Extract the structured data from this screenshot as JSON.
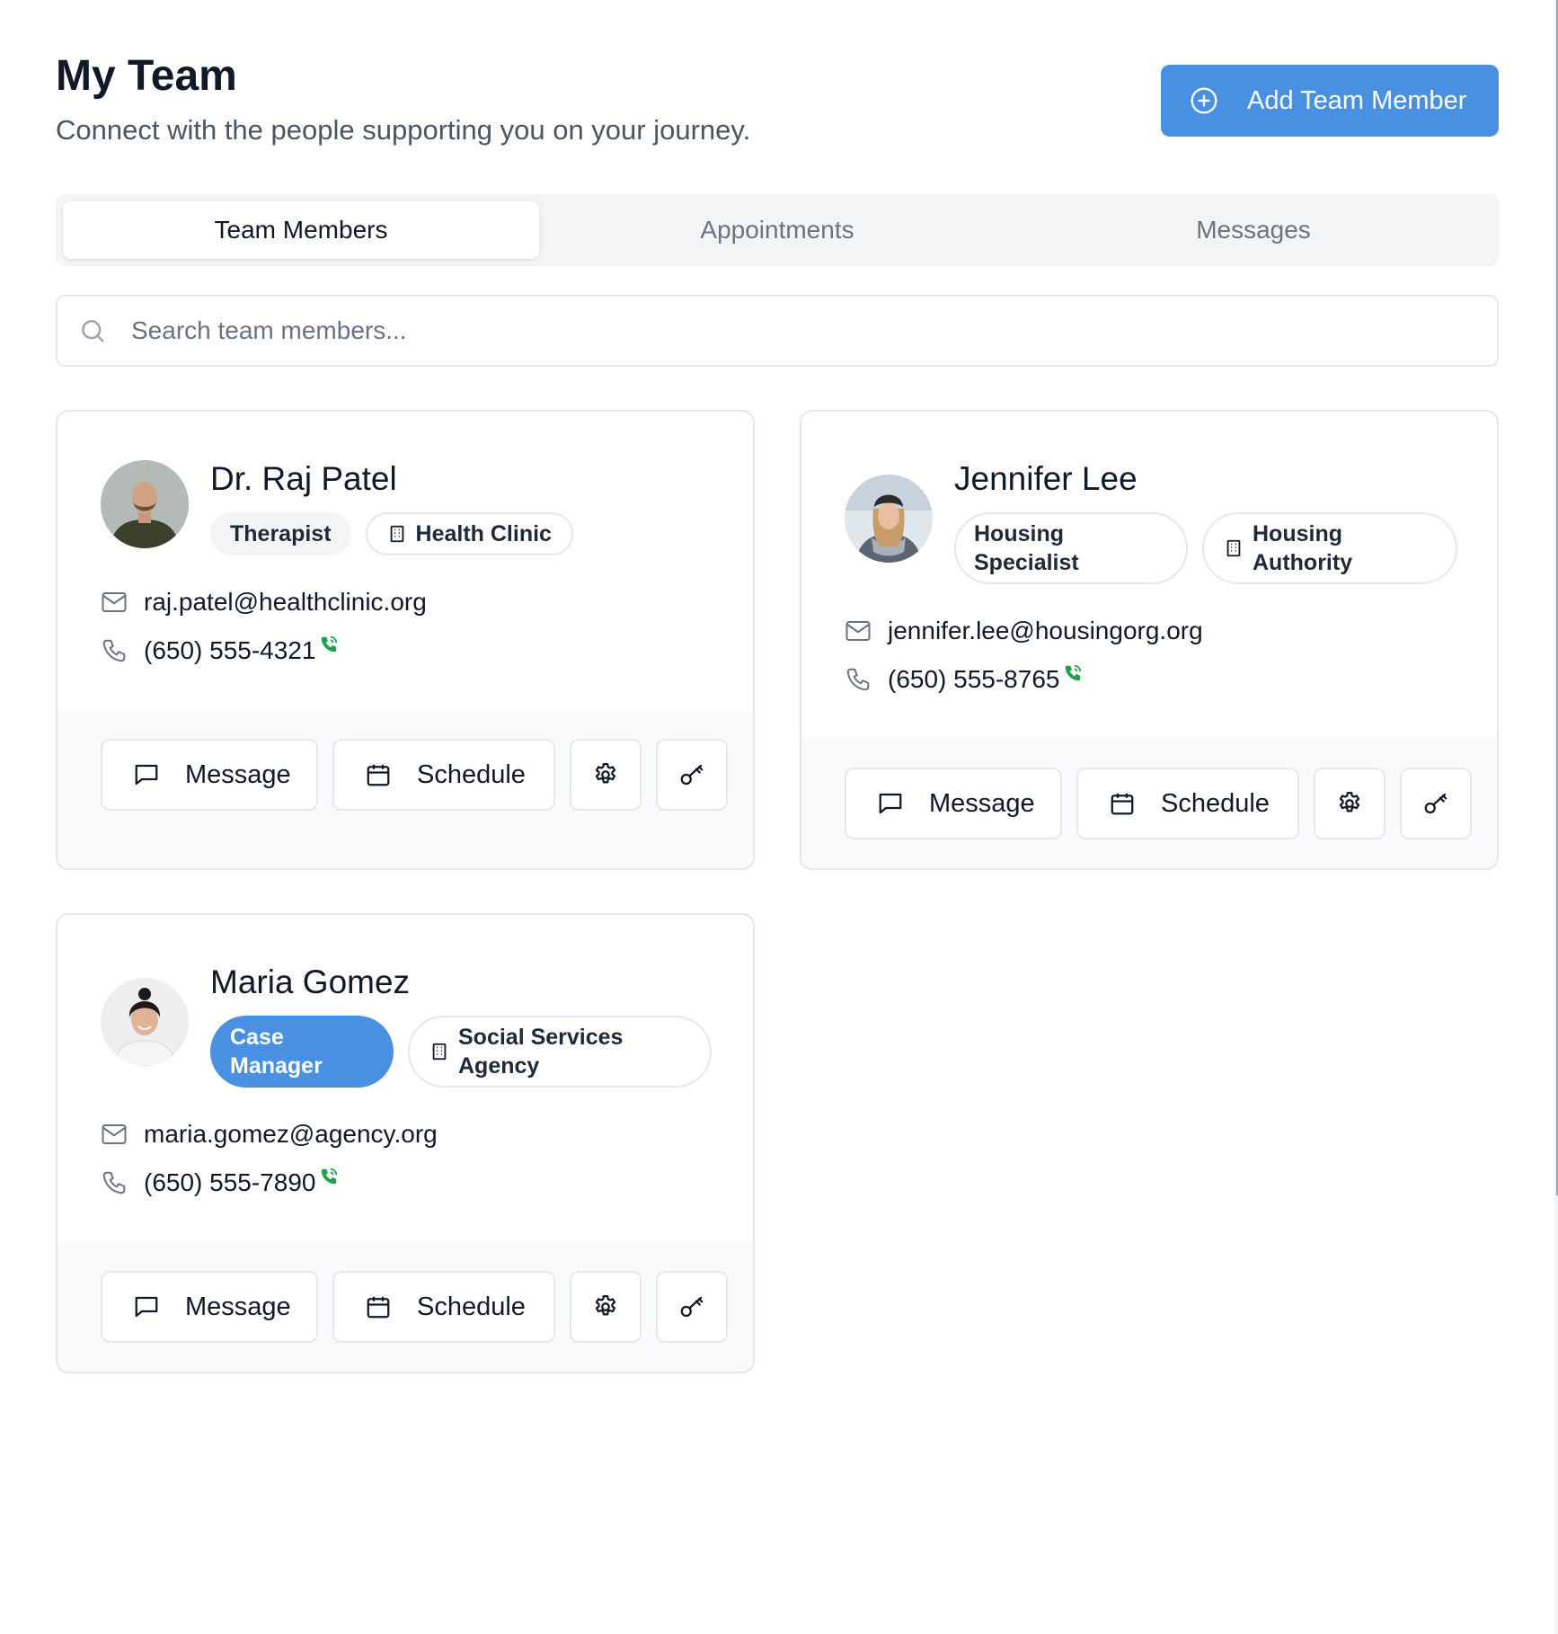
{
  "header": {
    "title": "My Team",
    "subtitle": "Connect with the people supporting you on your journey.",
    "add_button_label": "Add Team Member"
  },
  "tabs": [
    {
      "label": "Team Members",
      "active": true
    },
    {
      "label": "Appointments",
      "active": false
    },
    {
      "label": "Messages",
      "active": false
    }
  ],
  "search": {
    "placeholder": "Search team members...",
    "value": ""
  },
  "members": [
    {
      "name": "Dr. Raj Patel",
      "role": "Therapist",
      "organization": "Health Clinic",
      "email": "raj.patel@healthclinic.org",
      "phone": "(650) 555-4321",
      "message_label": "Message",
      "schedule_label": "Schedule"
    },
    {
      "name": "Jennifer Lee",
      "role": "Housing Specialist",
      "organization": "Housing Authority",
      "email": "jennifer.lee@housingorg.org",
      "phone": "(650) 555-8765",
      "message_label": "Message",
      "schedule_label": "Schedule"
    },
    {
      "name": "Maria Gomez",
      "role": "Case Manager",
      "organization": "Social Services Agency",
      "email": "maria.gomez@agency.org",
      "phone": "(650) 555-7890",
      "message_label": "Message",
      "schedule_label": "Schedule"
    }
  ],
  "colors": {
    "accent": "#4a90e2",
    "call_indicator": "#22a04b",
    "border": "#e5e7eb"
  },
  "icons": [
    "plus-circle-icon",
    "search-icon",
    "building-icon",
    "mail-icon",
    "phone-icon",
    "phone-call-icon",
    "message-square-icon",
    "calendar-icon",
    "gear-icon",
    "key-icon"
  ]
}
